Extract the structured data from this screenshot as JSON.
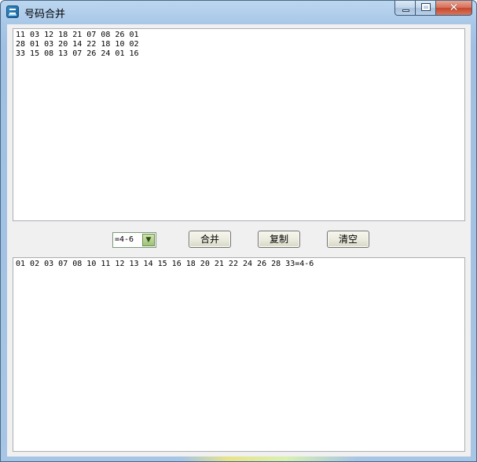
{
  "window": {
    "title": "号码合并",
    "app_icon": "app-logo-icon",
    "caption": {
      "minimize_icon": "minimize-icon",
      "maximize_icon": "maximize-icon",
      "close_glyph": "✕"
    }
  },
  "input": {
    "text": "11 03 12 18 21 07 08 26 01\n28 01 03 20 14 22 18 10 02\n33 15 08 13 07 26 24 01 16"
  },
  "controls": {
    "select_value": "=4-6",
    "select_arrow": "▼",
    "merge_label": "合并",
    "copy_label": "复制",
    "clear_label": "清空"
  },
  "output": {
    "text": "01 02 03 07 08 10 11 12 13 14 15 16 18 20 21 22 24 26 28 33=4-6"
  },
  "colors": {
    "frame": "#a7c5e4",
    "client_bg": "#f0f0f0",
    "close_button": "#c7462b",
    "combo_arrow": "#9fc278"
  }
}
